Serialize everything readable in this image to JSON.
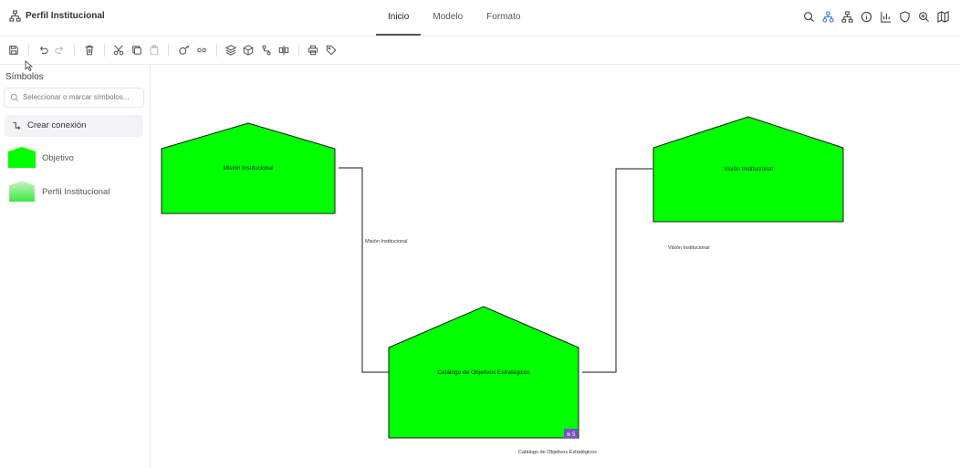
{
  "app": {
    "title": "Perfil Institucional"
  },
  "tabs": [
    {
      "label": "Inicio",
      "active": true
    },
    {
      "label": "Modelo",
      "active": false
    },
    {
      "label": "Formato",
      "active": false
    }
  ],
  "top_icons": [
    "search-icon",
    "hierarchy-icon",
    "tree-icon",
    "info-icon",
    "bar-chart-icon",
    "shield-icon",
    "zoom-in-icon",
    "map-icon"
  ],
  "toolbar_icons": [
    "save-icon",
    "undo-icon",
    "redo-icon",
    "delete-icon",
    "cut-icon",
    "copy-icon",
    "paste-icon",
    "connect-icon",
    "link-icon",
    "layers-icon",
    "cube-icon",
    "branch-icon",
    "split-icon",
    "print-icon",
    "tag-icon"
  ],
  "sidebar": {
    "title": "Símbolos",
    "search_placeholder": "Seleccionar o marcar símbolos...",
    "connection_label": "Crear conexión",
    "symbols": [
      {
        "label": "Objetivo"
      },
      {
        "label": "Perfil Institucional"
      }
    ]
  },
  "diagram": {
    "nodes": [
      {
        "label": "Misión Institucional"
      },
      {
        "label": "Visión Institucional"
      },
      {
        "label": "Catálogo de Objetivos Estratégicos",
        "badge": "≋ 5"
      }
    ],
    "edge_labels": [
      "Misión Institucional",
      "Visión Institucional",
      "Catálogo de Objetivos Estratégicos"
    ]
  },
  "colors": {
    "node_fill": "#00ff00",
    "node_stroke": "#1a1a1a",
    "edge": "#444444",
    "badge": "#7b4fc9"
  }
}
